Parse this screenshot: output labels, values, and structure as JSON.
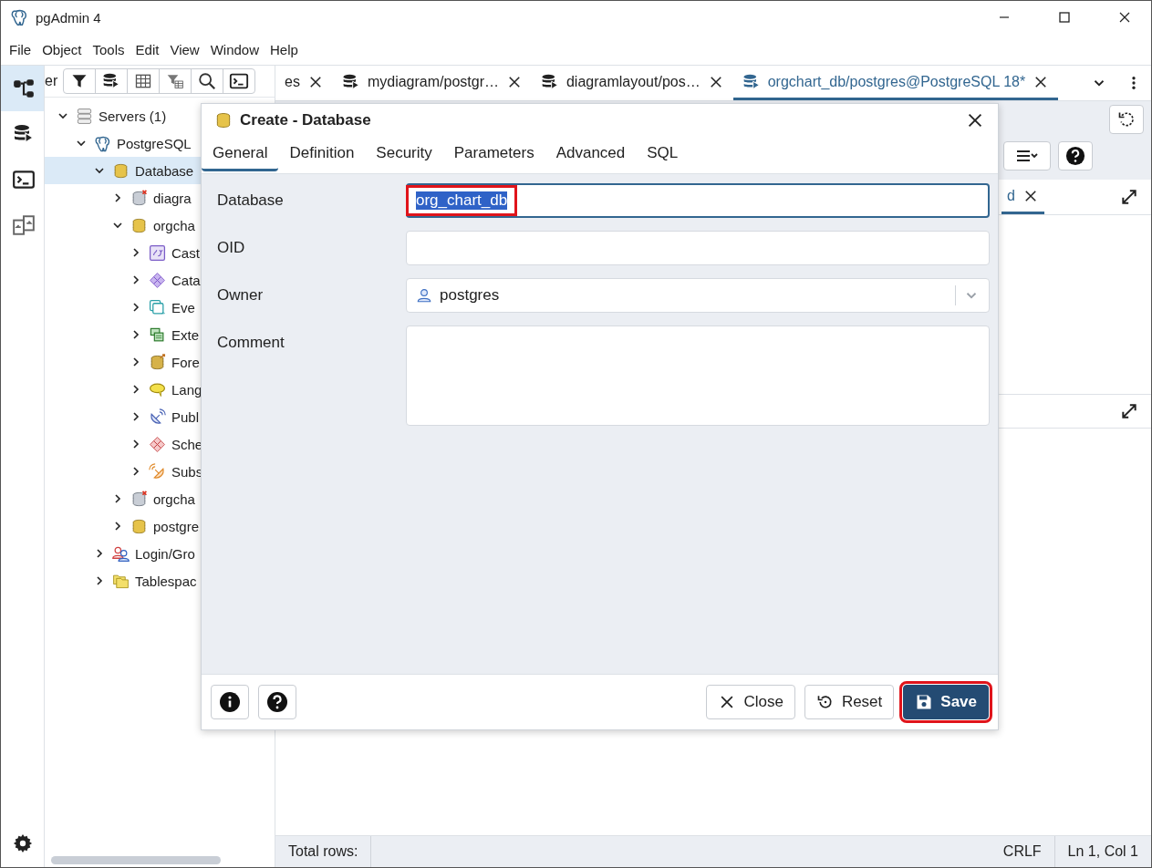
{
  "window": {
    "title": "pgAdmin 4"
  },
  "menu": [
    "File",
    "Object",
    "Tools",
    "Edit",
    "View",
    "Window",
    "Help"
  ],
  "rail": [
    {
      "kind": "explorer",
      "selected": true
    },
    {
      "kind": "query",
      "selected": false
    },
    {
      "kind": "terminal",
      "selected": false
    },
    {
      "kind": "compare",
      "selected": false
    }
  ],
  "browser": {
    "tab_label": "er"
  },
  "tree": [
    {
      "label": "Servers (1)",
      "kind": "servers",
      "expanded": true,
      "selected": false,
      "children": [
        {
          "label": "PostgreSQL",
          "kind": "server",
          "expanded": true,
          "selected": false,
          "children": [
            {
              "label": "Database",
              "kind": "databases",
              "expanded": true,
              "selected": true,
              "children": [
                {
                  "label": "diagra",
                  "kind": "database_off",
                  "expanded": false,
                  "selected": false
                },
                {
                  "label": "orgcha",
                  "kind": "database",
                  "expanded": true,
                  "selected": false,
                  "children": [
                    {
                      "label": "Cast",
                      "kind": "cast",
                      "expanded": false,
                      "selected": false
                    },
                    {
                      "label": "Cata",
                      "kind": "catalog",
                      "expanded": false,
                      "selected": false
                    },
                    {
                      "label": "Eve",
                      "kind": "event",
                      "expanded": false,
                      "selected": false
                    },
                    {
                      "label": "Exte",
                      "kind": "extension",
                      "expanded": false,
                      "selected": false
                    },
                    {
                      "label": "Fore",
                      "kind": "foreign",
                      "expanded": false,
                      "selected": false
                    },
                    {
                      "label": "Lang",
                      "kind": "language",
                      "expanded": false,
                      "selected": false
                    },
                    {
                      "label": "Publ",
                      "kind": "publication",
                      "expanded": false,
                      "selected": false
                    },
                    {
                      "label": "Sche",
                      "kind": "schema",
                      "expanded": false,
                      "selected": false
                    },
                    {
                      "label": "Subs",
                      "kind": "subscription",
                      "expanded": false,
                      "selected": false
                    }
                  ]
                },
                {
                  "label": "orgcha",
                  "kind": "database_off",
                  "expanded": false,
                  "selected": false
                },
                {
                  "label": "postgre",
                  "kind": "database",
                  "expanded": false,
                  "selected": false
                }
              ]
            },
            {
              "label": "Login/Gro",
              "kind": "login",
              "expanded": false,
              "selected": false
            },
            {
              "label": "Tablespac",
              "kind": "tablespace",
              "expanded": false,
              "selected": false
            }
          ]
        }
      ]
    }
  ],
  "tabs": [
    {
      "label": "es",
      "kind": "plain",
      "selected": false
    },
    {
      "label": "mydiagram/postgr…",
      "kind": "query",
      "selected": false
    },
    {
      "label": "diagramlayout/pos…",
      "kind": "query",
      "selected": false
    },
    {
      "label": "orgchart_db/postgres@PostgreSQL 18*",
      "kind": "query",
      "selected": true
    }
  ],
  "panel_tab": {
    "label": "d"
  },
  "dialog": {
    "title": "Create - Database",
    "tabs": [
      {
        "label": "General",
        "selected": true
      },
      {
        "label": "Definition",
        "selected": false
      },
      {
        "label": "Security",
        "selected": false
      },
      {
        "label": "Parameters",
        "selected": false
      },
      {
        "label": "Advanced",
        "selected": false
      },
      {
        "label": "SQL",
        "selected": false
      }
    ],
    "fields": [
      {
        "label": "Database",
        "kind": "text",
        "value": "org_chart_db",
        "text_selected": true,
        "highlighted": true
      },
      {
        "label": "OID",
        "kind": "text"
      },
      {
        "label": "Owner",
        "kind": "select",
        "value": "postgres"
      },
      {
        "label": "Comment",
        "kind": "textarea"
      }
    ],
    "buttons": [
      {
        "label": "Close",
        "kind": "close",
        "highlighted": false
      },
      {
        "label": "Reset",
        "kind": "reset",
        "highlighted": false
      },
      {
        "label": "Save",
        "kind": "save",
        "highlighted": true
      }
    ]
  },
  "status_bar": {
    "total_rows": "Total rows:",
    "line_ending": "CRLF",
    "position": "Ln 1, Col 1"
  }
}
